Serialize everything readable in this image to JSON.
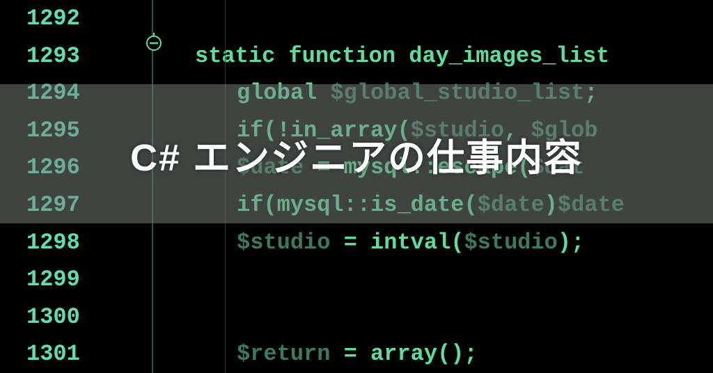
{
  "overlay": {
    "title": "C# エンジニアの仕事内容"
  },
  "editor": {
    "lineStart": 1292,
    "lineEnd": 1301,
    "lines": [
      {
        "num": "1292",
        "indent": 0,
        "segments": []
      },
      {
        "num": "1293",
        "indent": 0,
        "segments": [
          {
            "t": "static function day_images_list",
            "c": "kw"
          }
        ]
      },
      {
        "num": "1294",
        "indent": 1,
        "segments": [
          {
            "t": "global ",
            "c": "kw"
          },
          {
            "t": "$global_studio_list",
            "c": "dim"
          },
          {
            "t": ";",
            "c": "kw"
          }
        ]
      },
      {
        "num": "1295",
        "indent": 1,
        "segments": [
          {
            "t": "if(!in_array(",
            "c": "kw"
          },
          {
            "t": "$studio",
            "c": "dim"
          },
          {
            "t": ", ",
            "c": "kw"
          },
          {
            "t": "$glob",
            "c": "dim"
          }
        ]
      },
      {
        "num": "1296",
        "indent": 1,
        "segments": [
          {
            "t": "$date",
            "c": "dim"
          },
          {
            "t": " = mysql::escape(",
            "c": "kw"
          },
          {
            "t": "$dat",
            "c": "dim"
          }
        ]
      },
      {
        "num": "1297",
        "indent": 1,
        "segments": [
          {
            "t": "if(mysql::is_date(",
            "c": "kw"
          },
          {
            "t": "$date",
            "c": "dim"
          },
          {
            "t": ")",
            "c": "kw"
          },
          {
            "t": "$date",
            "c": "dim"
          }
        ]
      },
      {
        "num": "1298",
        "indent": 1,
        "segments": [
          {
            "t": "$studio",
            "c": "dim"
          },
          {
            "t": " = intval(",
            "c": "kw"
          },
          {
            "t": "$studio",
            "c": "dim"
          },
          {
            "t": ");",
            "c": "kw"
          }
        ]
      },
      {
        "num": "1299",
        "indent": 0,
        "segments": []
      },
      {
        "num": "1300",
        "indent": 0,
        "segments": []
      },
      {
        "num": "1301",
        "indent": 1,
        "segments": [
          {
            "t": "$return",
            "c": "dim"
          },
          {
            "t": " = array();",
            "c": "kw"
          }
        ]
      }
    ]
  }
}
